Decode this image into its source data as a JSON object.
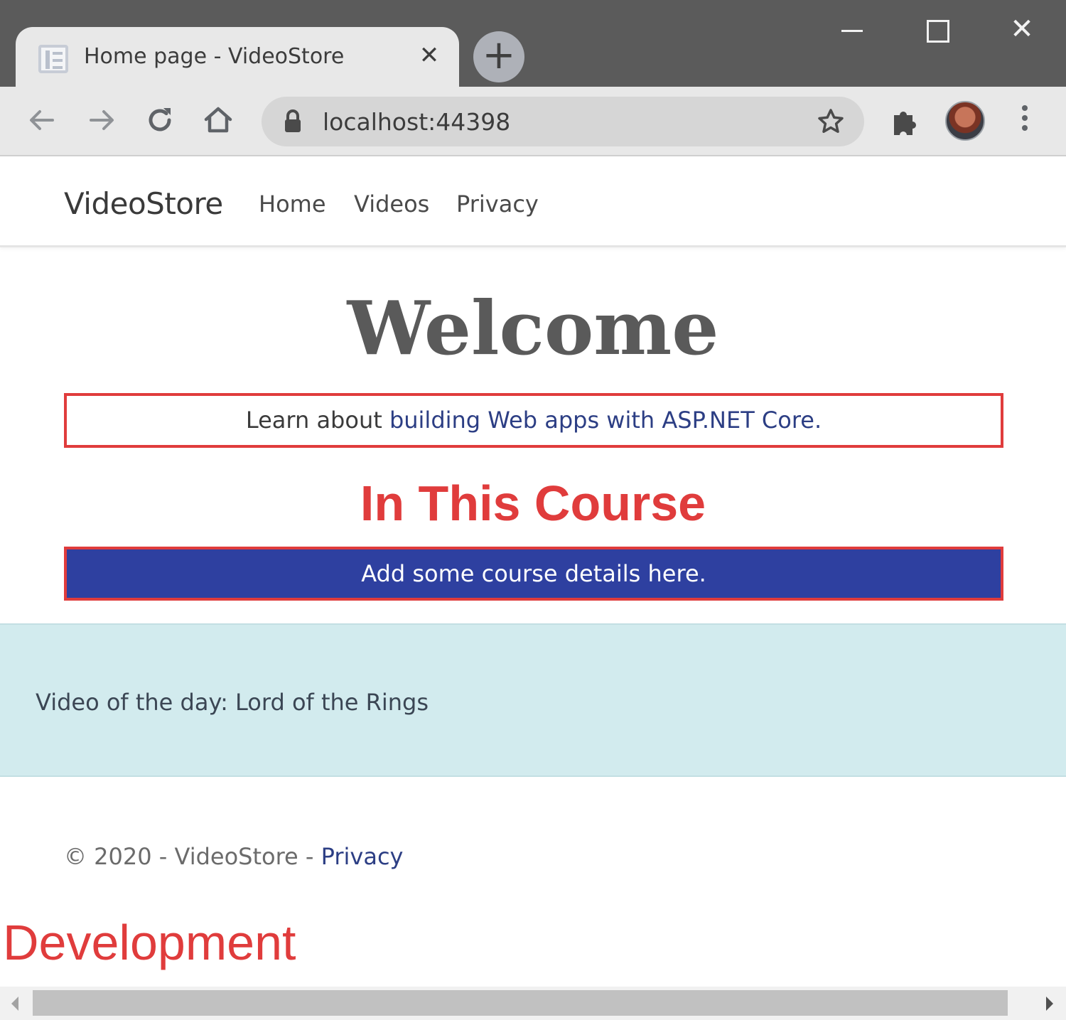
{
  "browser": {
    "tab_title": "Home page - VideoStore",
    "tab_close": "✕",
    "new_tab": "+",
    "url": "localhost:44398",
    "window_close": "✕"
  },
  "site": {
    "brand": "VideoStore",
    "nav": {
      "home": "Home",
      "videos": "Videos",
      "privacy": "Privacy"
    }
  },
  "main": {
    "welcome": "Welcome",
    "learn_prefix": "Learn about ",
    "learn_link": "building Web apps with ASP.NET Core.",
    "course_heading": "In This Course",
    "course_details": "Add some course details here.",
    "video_of_day": "Video of the day: Lord of the Rings"
  },
  "footer": {
    "copyright": "© 2020 - VideoStore - ",
    "privacy_link": "Privacy"
  },
  "environment_label": "Development",
  "colors": {
    "highlight_red": "#e03c3c",
    "details_bg": "#2e40a0",
    "banner_bg": "#d2ebee",
    "link": "#2c3e84"
  }
}
